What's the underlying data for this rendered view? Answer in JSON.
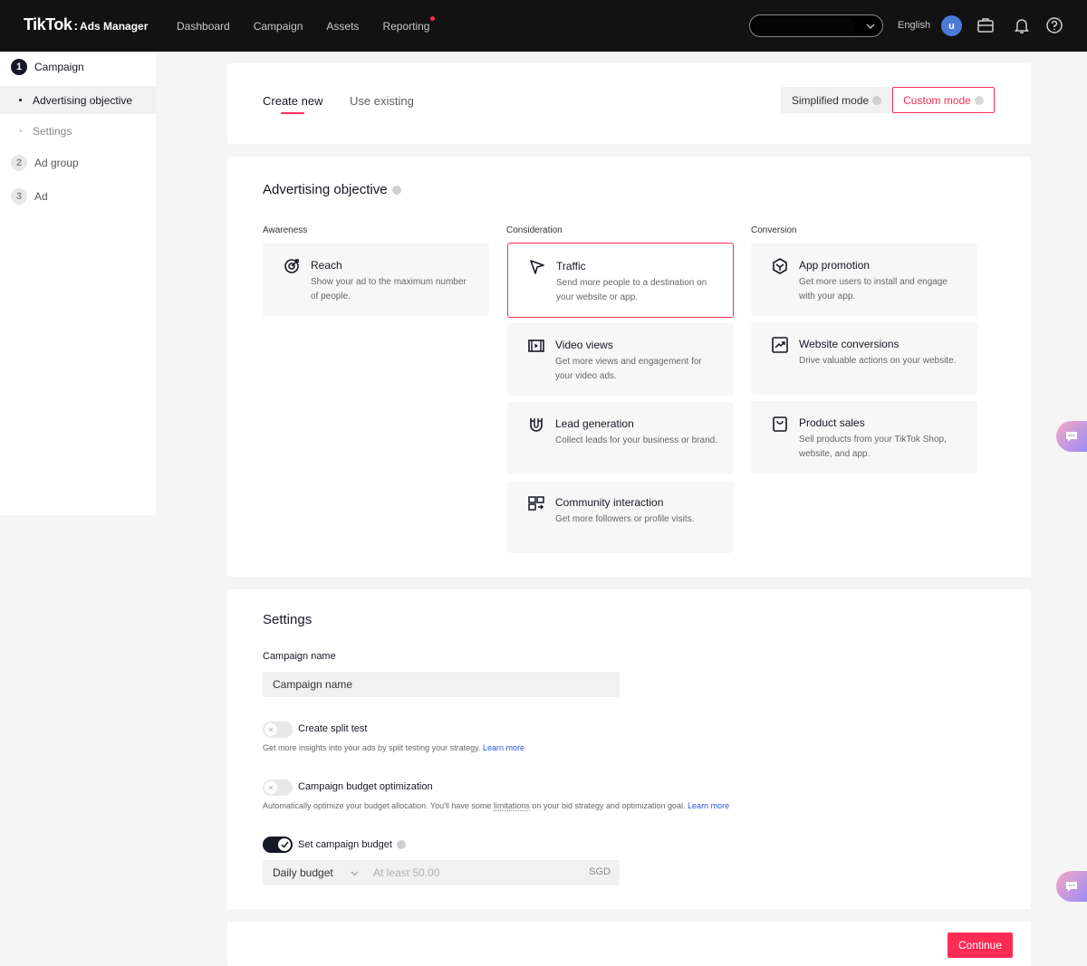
{
  "header": {
    "brand": "TikTok",
    "brand_sub": "Ads Manager",
    "nav": [
      "Dashboard",
      "Campaign",
      "Assets",
      "Reporting"
    ],
    "language": "English",
    "avatar_initial": "u"
  },
  "sidebar": {
    "steps": [
      {
        "num": "1",
        "label": "Campaign"
      },
      {
        "num": "2",
        "label": "Ad group"
      },
      {
        "num": "3",
        "label": "Ad"
      }
    ],
    "substeps": [
      "Advertising objective",
      "Settings"
    ]
  },
  "top_card": {
    "tab_create": "Create new",
    "tab_existing": "Use existing",
    "mode_simplified": "Simplified mode",
    "mode_custom": "Custom mode"
  },
  "objective": {
    "heading": "Advertising objective",
    "columns": [
      "Awareness",
      "Consideration",
      "Conversion"
    ],
    "reach": {
      "title": "Reach",
      "desc": "Show your ad to the maximum number of people."
    },
    "traffic": {
      "title": "Traffic",
      "desc": "Send more people to a destination on your website or app."
    },
    "video": {
      "title": "Video views",
      "desc": "Get more views and engagement for your video ads."
    },
    "lead": {
      "title": "Lead generation",
      "desc": "Collect leads for your business or brand."
    },
    "community": {
      "title": "Community interaction",
      "desc": "Get more followers or profile visits."
    },
    "app": {
      "title": "App promotion",
      "desc": "Get more users to install and engage with your app."
    },
    "website": {
      "title": "Website conversions",
      "desc": "Drive valuable actions on your website."
    },
    "product": {
      "title": "Product sales",
      "desc": "Sell products from your TikTok Shop, website, and app."
    }
  },
  "settings": {
    "heading": "Settings",
    "campaign_name_label": "Campaign name",
    "campaign_name_value": "Campaign name",
    "split_test_label": "Create split test",
    "split_test_hint": "Get more insights into your ads by split testing your strategy.",
    "learn_more": "Learn more",
    "cbo_label": "Campaign budget optimization",
    "cbo_hint_pre": "Automatically optimize your budget allocation. You'll have some",
    "cbo_hint_link": "limitations",
    "cbo_hint_post": "on your bid strategy and optimization goal.",
    "budget_label": "Set campaign budget",
    "budget_type": "Daily budget",
    "budget_placeholder": "At least 50.00",
    "currency": "SGD"
  },
  "footer": {
    "continue": "Continue"
  }
}
